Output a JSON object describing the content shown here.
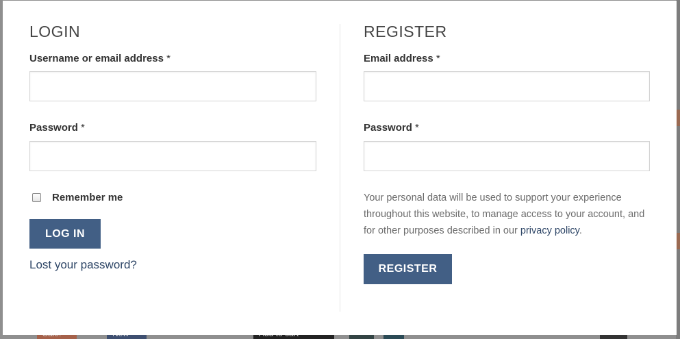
{
  "background_page": {
    "badge_sale": "Sale!",
    "badge_new": "New",
    "add_to_cart": "Add to cart"
  },
  "login": {
    "title": "LOGIN",
    "username_label": "Username or email address",
    "password_label": "Password",
    "required_mark": "*",
    "username_value": "",
    "password_value": "",
    "remember_label": "Remember me",
    "remember_checked": false,
    "submit_label": "LOG IN",
    "lost_password_link": "Lost your password?"
  },
  "register": {
    "title": "REGISTER",
    "email_label": "Email address",
    "password_label": "Password",
    "required_mark": "*",
    "email_value": "",
    "password_value": "",
    "privacy_text": "Your personal data will be used to support your experience throughout this website, to manage access to your account, and for other purposes described in our ",
    "privacy_link": "privacy policy",
    "privacy_suffix": ".",
    "submit_label": "REGISTER"
  },
  "colors": {
    "button_bg": "#425f85",
    "link": "#2d4566",
    "overlay": "#8f8f8f"
  }
}
